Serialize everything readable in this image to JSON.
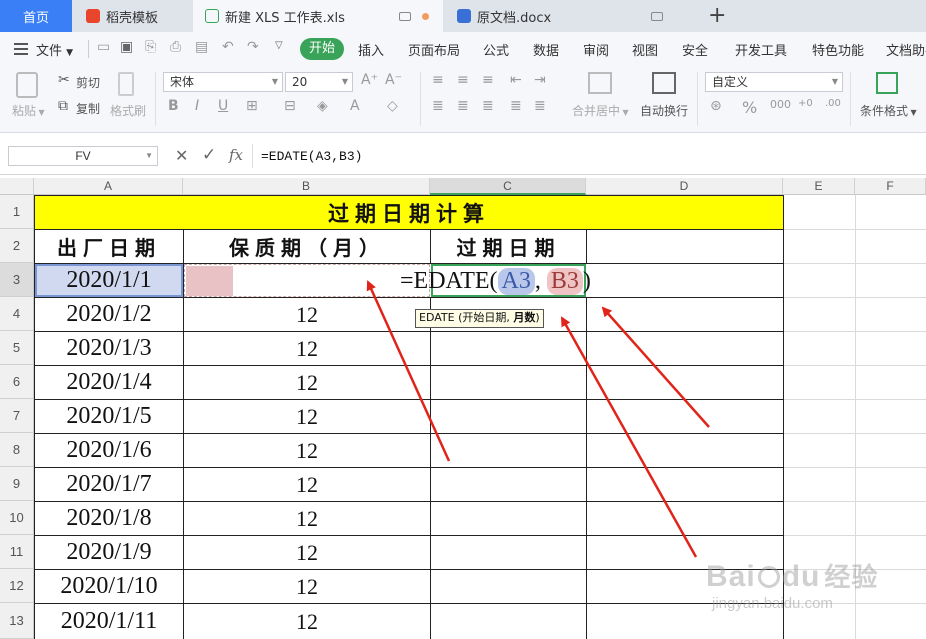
{
  "tabs": [
    {
      "label": "首页"
    },
    {
      "label": "稻壳模板"
    },
    {
      "label": "新建 XLS 工作表.xls"
    },
    {
      "label": "原文档.docx"
    }
  ],
  "menu": {
    "file": "文件",
    "items": [
      "开始",
      "插入",
      "页面布局",
      "公式",
      "数据",
      "审阅",
      "视图",
      "安全",
      "开发工具",
      "特色功能",
      "文档助手"
    ]
  },
  "ribbon": {
    "paste": "粘贴",
    "cut": "剪切",
    "copy": "复制",
    "format_painter": "格式刷",
    "font_name": "宋体",
    "font_size": "20",
    "merge_center": "合并居中",
    "wrap_text": "自动换行",
    "number_format": "自定义",
    "conditional_format": "条件格式"
  },
  "formula_bar": {
    "name_box": "FV",
    "fx": "fx",
    "formula": "=EDATE(A3,B3)"
  },
  "columns": [
    "A",
    "B",
    "C",
    "D",
    "E",
    "F"
  ],
  "rows": [
    "1",
    "2",
    "3",
    "4",
    "5",
    "6",
    "7",
    "8",
    "9",
    "10",
    "11",
    "12",
    "13"
  ],
  "sheet": {
    "title": "过期日期计算",
    "headers": [
      "出厂日期",
      "保质期（月）",
      "过期日期"
    ],
    "dates": [
      "2020/1/1",
      "2020/1/2",
      "2020/1/3",
      "2020/1/4",
      "2020/1/5",
      "2020/1/6",
      "2020/1/7",
      "2020/1/8",
      "2020/1/9",
      "2020/1/10",
      "2020/1/11"
    ],
    "months": [
      "12",
      "12",
      "12",
      "12",
      "12",
      "12",
      "12",
      "12",
      "12",
      "12"
    ],
    "editing_formula": {
      "prefix": "=EDATE(",
      "arg1": "A3",
      "comma": ",",
      "arg2": "B3",
      "suffix": ")"
    },
    "tooltip": {
      "text": "EDATE (开始日期, ",
      "bold": "月数",
      "end": ")"
    }
  },
  "watermark": {
    "brand": "Bai",
    "brand2": "du",
    "cn": "经验",
    "url": "jingyan.baidu.com"
  },
  "colors": {
    "title_fill": "#ffff00",
    "accent_green": "#3aa35a",
    "arrow_red": "#e0241a",
    "ref_blue": "#b9c8ea",
    "ref_pink": "#f0c4c4"
  }
}
